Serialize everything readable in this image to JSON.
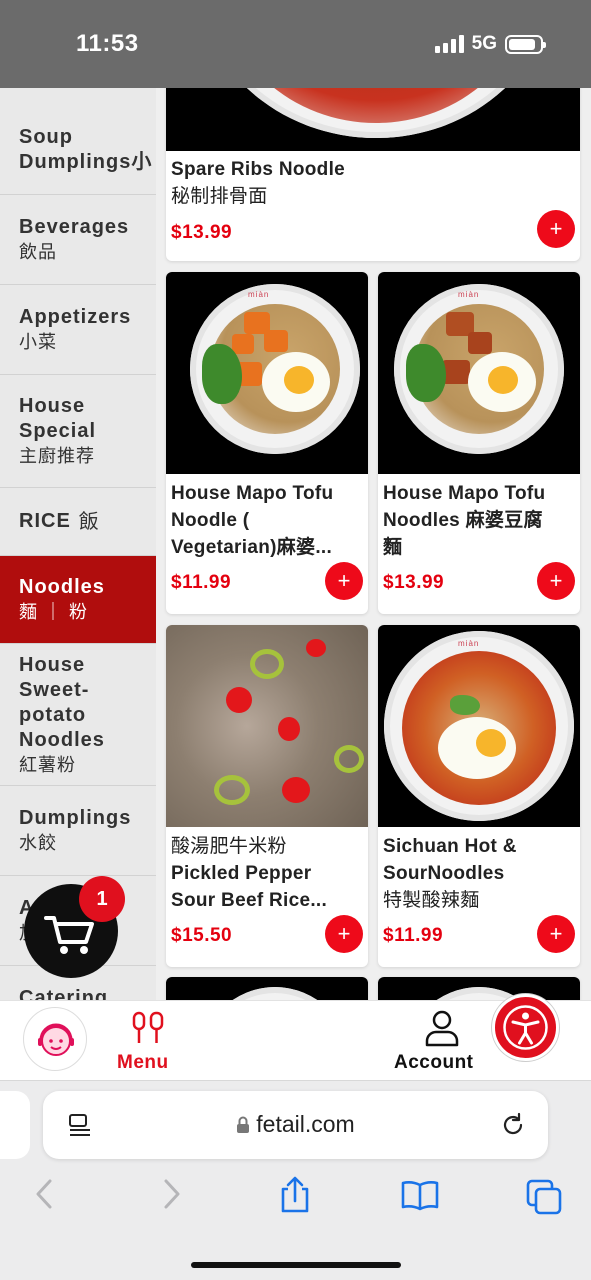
{
  "status_bar": {
    "time": "11:53",
    "network": "5G"
  },
  "categories": [
    {
      "en": "Soup\nDumplings小",
      "zh": ""
    },
    {
      "en": "Beverages",
      "zh": "飲品"
    },
    {
      "en": "Appetizers",
      "zh": "小菜"
    },
    {
      "en": "House\nSpecial",
      "zh": "主廚推荐"
    },
    {
      "en": "RICE",
      "zh": "飯"
    },
    {
      "en": "Noodles",
      "zh": "麵 ｜ 粉"
    },
    {
      "en": "House\nSweet-potato\nNoodles",
      "zh": "紅薯粉"
    },
    {
      "en": "Dumplings",
      "zh": "水餃"
    },
    {
      "en": "A        &S",
      "zh": "加"
    },
    {
      "en": "Catering",
      "zh": ""
    }
  ],
  "active_category": "Noodles",
  "items": [
    {
      "name_en": "Spare Ribs Noodle",
      "name_zh": "秘制排骨面",
      "price": "$13.99"
    },
    {
      "name_l1": "House Mapo Tofu",
      "name_l2": "Noodle (",
      "name_l3": "Vegetarian)麻婆...",
      "price": "$11.99"
    },
    {
      "name_l1": "House Mapo Tofu",
      "name_l2": "Noodles 麻婆豆腐",
      "name_l3": "麵",
      "price": "$13.99"
    },
    {
      "name_l1": "酸湯肥牛米粉",
      "name_l2": "Pickled Pepper",
      "name_l3": "Sour Beef Rice...",
      "price": "$15.50"
    },
    {
      "name_l1": "Sichuan Hot &",
      "name_l2": "SourNoodles",
      "name_l3": "特製酸辣麵",
      "price": "$11.99"
    }
  ],
  "add_symbol": "+",
  "plate_brand": "miàn",
  "cart": {
    "count": "1"
  },
  "bottom_nav": {
    "menu_label": "Menu",
    "account_label": "Account"
  },
  "browser": {
    "url": "fetail.com"
  },
  "colors": {
    "accent": "#e0101e",
    "active_category": "#b00d0d"
  }
}
